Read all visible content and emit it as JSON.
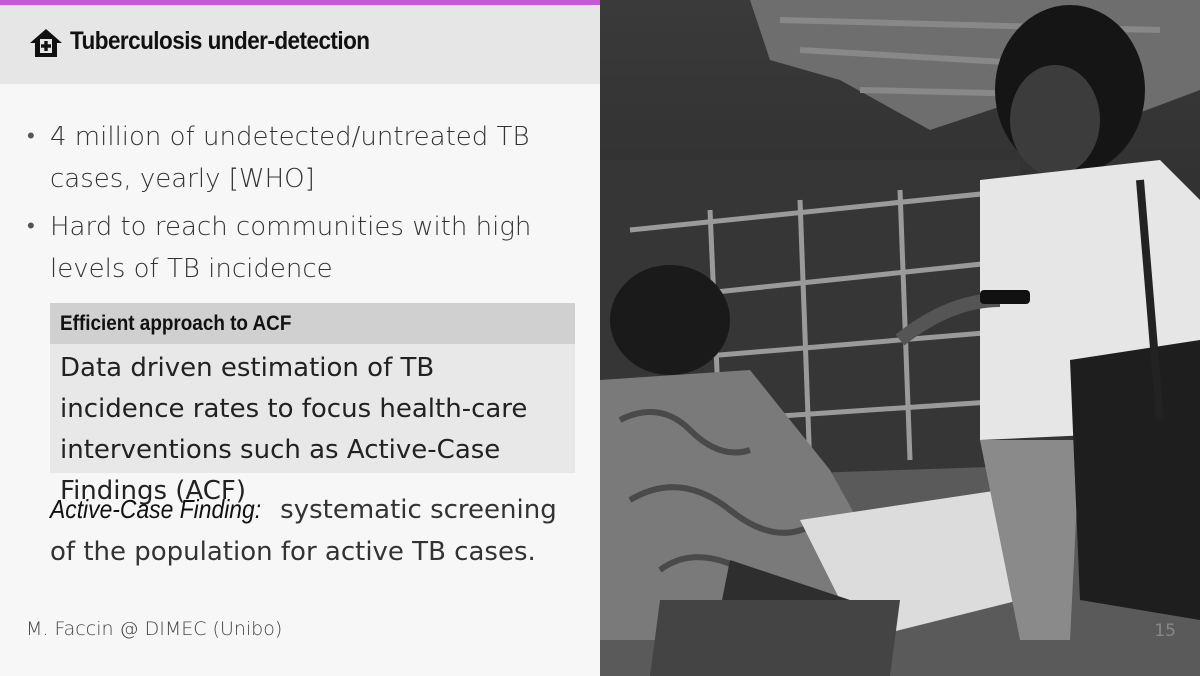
{
  "colors": {
    "accent_bar": "#c35bd6",
    "header_bg": "#e6e6e6",
    "box_header_bg": "#d0d0d0",
    "box_body_bg": "#e8e8e8"
  },
  "header": {
    "icon": "home-health-icon",
    "title": "Tuberculosis under-detection"
  },
  "bullets": [
    "4 million of undetected/untreated TB cases, yearly [WHO]",
    "Hard to reach communities with high levels of TB incidence"
  ],
  "callout": {
    "title": "Efficient approach to ACF",
    "body": "Data driven estimation of TB incidence rates to focus health-care interventions such as Active-Case Findings (ACF)"
  },
  "definition": {
    "term": "Active-Case Finding:",
    "text": "systematic screening of the population for active TB cases."
  },
  "footer": {
    "author": "M. Faccin @ DIMEC (Unibo)",
    "page_number": "15"
  },
  "photo": {
    "subject": "health worker with mobile phone speaking to seated man in a settlement (grayscale)"
  }
}
